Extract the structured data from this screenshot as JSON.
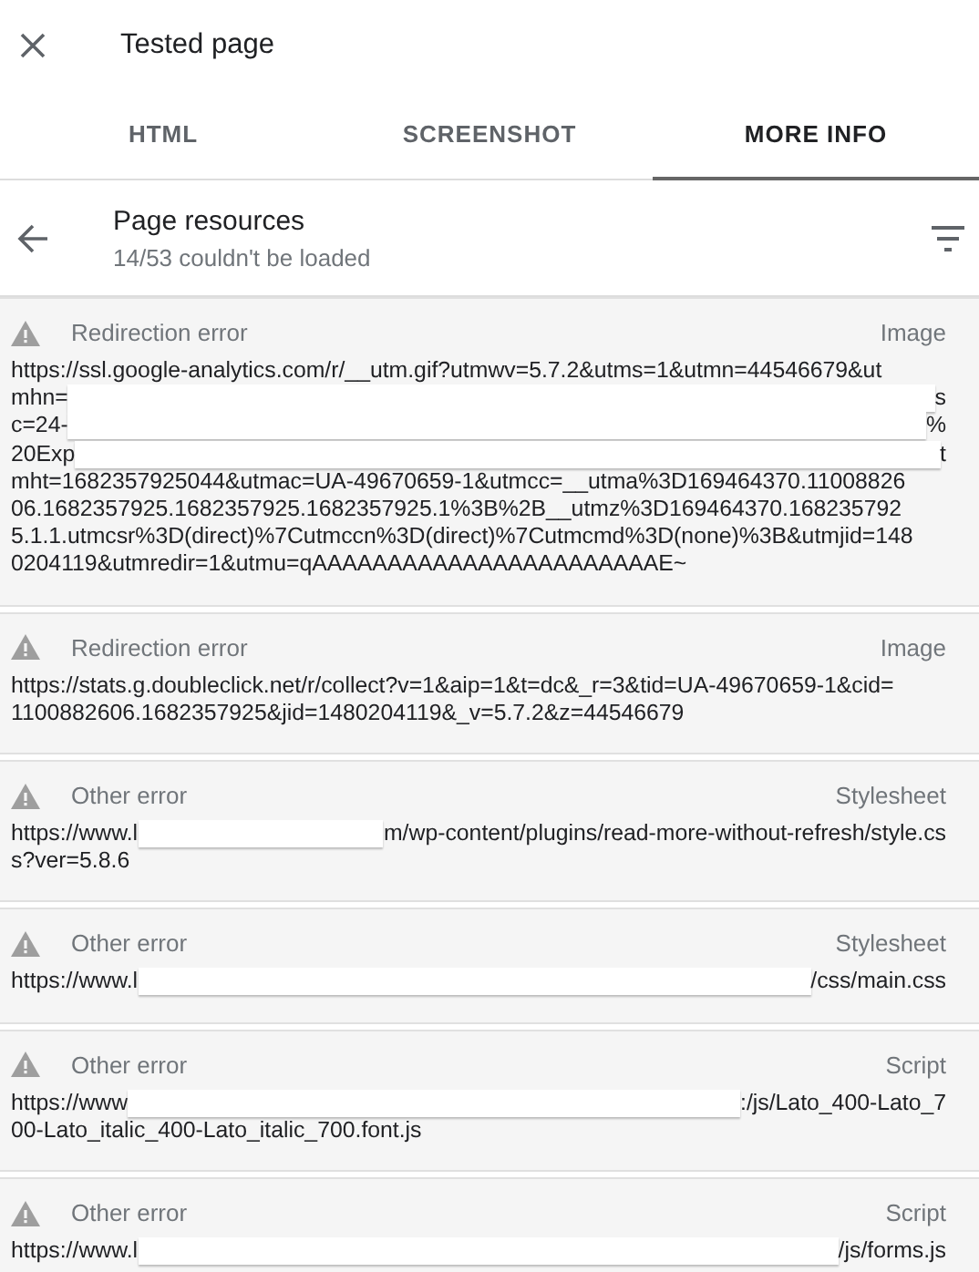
{
  "header": {
    "title": "Tested page"
  },
  "tabs": [
    {
      "label": "HTML",
      "selected": false
    },
    {
      "label": "SCREENSHOT",
      "selected": false
    },
    {
      "label": "MORE INFO",
      "selected": true
    }
  ],
  "section": {
    "title": "Page resources",
    "subtitle": "14/53 couldn't be loaded"
  },
  "resources": [
    {
      "error": "Redirection error",
      "type": "Image",
      "url_lines": [
        [
          {
            "kind": "text",
            "text": "https://ssl.google-analytics.com/r/__utm.gif?utmwv=5.7.2&utms=1&utmn=44546679&ut"
          }
        ],
        [
          {
            "kind": "text",
            "text": "mhn="
          },
          {
            "kind": "redacted"
          },
          {
            "kind": "text",
            "text": "s"
          }
        ],
        [
          {
            "kind": "text",
            "text": "c=24-"
          },
          {
            "kind": "redacted"
          },
          {
            "kind": "text",
            "text": "%"
          }
        ],
        [
          {
            "kind": "text",
            "text": "20Exp"
          },
          {
            "kind": "redacted"
          },
          {
            "kind": "text",
            "text": "t"
          }
        ],
        [
          {
            "kind": "text",
            "text": "mht=1682357925044&utmac=UA-49670659-1&utmcc=__utma%3D169464370.11008826"
          }
        ],
        [
          {
            "kind": "text",
            "text": "06.1682357925.1682357925.1682357925.1%3B%2B__utmz%3D169464370.168235792"
          }
        ],
        [
          {
            "kind": "text",
            "text": "5.1.1.utmcsr%3D(direct)%7Cutmccn%3D(direct)%7Cutmcmd%3D(none)%3B&utmjid=148"
          }
        ],
        [
          {
            "kind": "text",
            "text": "0204119&utmredir=1&utmu=qAAAAAAAAAAAAAAAAAAAAAAAE~"
          }
        ]
      ]
    },
    {
      "error": "Redirection error",
      "type": "Image",
      "url_lines": [
        [
          {
            "kind": "text",
            "text": "https://stats.g.doubleclick.net/r/collect?v=1&aip=1&t=dc&_r=3&tid=UA-49670659-1&cid="
          }
        ],
        [
          {
            "kind": "text",
            "text": "1100882606.1682357925&jid=1480204119&_v=5.7.2&z=44546679"
          }
        ]
      ]
    },
    {
      "error": "Other error",
      "type": "Stylesheet",
      "url_lines": [
        [
          {
            "kind": "text",
            "text": "https://www.l"
          },
          {
            "kind": "redacted"
          },
          {
            "kind": "text",
            "text": "m/wp-content/plugins/read-more-without-refresh/style.cs"
          }
        ],
        [
          {
            "kind": "text",
            "text": "s?ver=5.8.6"
          }
        ]
      ]
    },
    {
      "error": "Other error",
      "type": "Stylesheet",
      "url_lines": [
        [
          {
            "kind": "text",
            "text": "https://www.l"
          },
          {
            "kind": "redacted"
          },
          {
            "kind": "text",
            "text": "/css/main.css"
          }
        ]
      ]
    },
    {
      "error": "Other error",
      "type": "Script",
      "url_lines": [
        [
          {
            "kind": "text",
            "text": "https://www"
          },
          {
            "kind": "redacted"
          },
          {
            "kind": "text",
            "text": ":/js/Lato_400-Lato_7"
          }
        ],
        [
          {
            "kind": "text",
            "text": "00-Lato_italic_400-Lato_italic_700.font.js"
          }
        ]
      ]
    },
    {
      "error": "Other error",
      "type": "Script",
      "url_lines": [
        [
          {
            "kind": "text",
            "text": "https://www.l"
          },
          {
            "kind": "redacted"
          },
          {
            "kind": "text",
            "text": "/js/forms.js"
          }
        ]
      ]
    }
  ]
}
